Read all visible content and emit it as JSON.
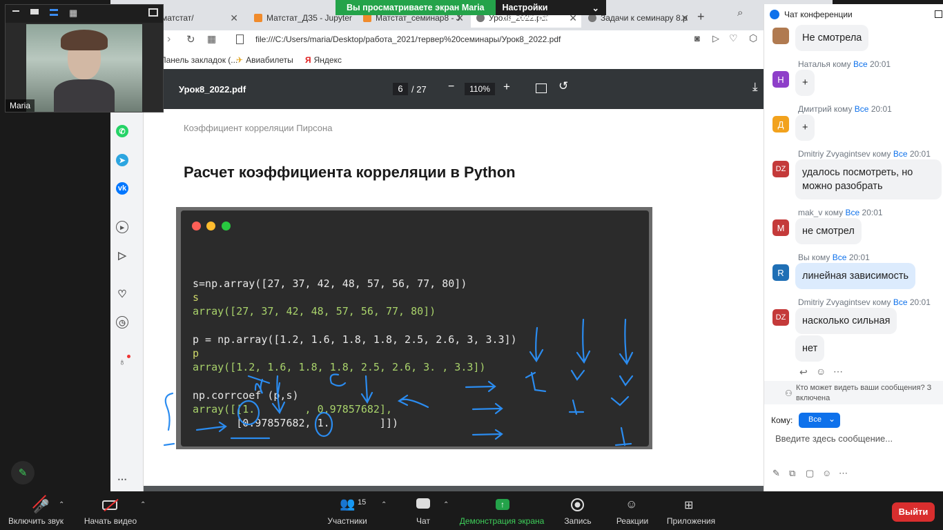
{
  "banner": {
    "viewing_text": "Вы просматриваете экран Maria",
    "options_label": "Настройки просмотра"
  },
  "video": {
    "name": "Maria"
  },
  "browser": {
    "tabs": [
      {
        "label": "матстат/"
      },
      {
        "label": "Матстат_ДЗ5 - Jupyter"
      },
      {
        "label": "Матстат_семинар8 - J"
      },
      {
        "label": "Урок8_2022.pdf"
      },
      {
        "label": "Задачи к семинару 8.p"
      }
    ],
    "url": "file:///C:/Users/maria/Desktop/работа_2021/тервер%20семинары/Урок8_2022.pdf",
    "bookmarks": [
      {
        "label": "Панель закладок (..."
      },
      {
        "label": "Авиабилеты"
      },
      {
        "label": "Яндекс"
      }
    ]
  },
  "pdf": {
    "filename": "Урок8_2022.pdf",
    "page_current": "6",
    "page_total": "/ 27",
    "zoom": "110%",
    "page_header": "Коэффициент корреляции Пирсона",
    "page_title": "Расчет коэффициента корреляции в Python",
    "code_lines": [
      "s=np.array([27, 37, 42, 48, 57, 56, 77, 80])",
      "s",
      "array([27, 37, 42, 48, 57, 56, 77, 80])",
      "p = np.array([1.2, 1.6, 1.8, 1.8, 2.5, 2.6, 3, 3.3])",
      "p",
      "array([1.2, 1.6, 1.8, 1.8, 2.5, 2.6, 3. , 3.3])",
      "np.corrcoef (p,s)",
      "array([[1.        , 0.97857682],",
      "       [0.97857682, 1.        ]])"
    ]
  },
  "chat": {
    "title": "Чат конференции",
    "messages": [
      {
        "avatar": "",
        "sender": "",
        "to_label": "",
        "to": "",
        "time": "",
        "text": "Не смотрела",
        "avatar_color": "#b07a50"
      },
      {
        "avatar": "Н",
        "sender": "Наталья",
        "to_label": "кому",
        "to": "Все",
        "time": "20:01",
        "text": "+",
        "avatar_color": "#8e3fc9"
      },
      {
        "avatar": "Д",
        "sender": "Дмитрий",
        "to_label": "кому",
        "to": "Все",
        "time": "20:01",
        "text": "+",
        "avatar_color": "#f2a21d"
      },
      {
        "avatar": "DZ",
        "sender": "Dmitriy Zvyagintsev",
        "to_label": "кому",
        "to": "Все",
        "time": "20:01",
        "text": "удалось посмотреть, но можно разобрать",
        "avatar_color": "#c43a3a"
      },
      {
        "avatar": "M",
        "sender": "mak_v",
        "to_label": "кому",
        "to": "Все",
        "time": "20:01",
        "text": "не смотрел",
        "avatar_color": "#c43a3a"
      },
      {
        "avatar": "R",
        "sender": "Вы",
        "to_label": "кому",
        "to": "Все",
        "time": "20:01",
        "text": "линейная зависимость",
        "avatar_color": "#1f6fb5"
      },
      {
        "avatar": "DZ",
        "sender": "Dmitriy Zvyagintsev",
        "to_label": "кому",
        "to": "Все",
        "time": "20:01",
        "text": "насколько сильная",
        "avatar_color": "#c43a3a"
      },
      {
        "avatar": "",
        "sender": "",
        "to_label": "",
        "to": "",
        "time": "",
        "text": "нет",
        "avatar_color": ""
      }
    ],
    "privacy_note_1": "Кто может видеть ваши сообщения? З",
    "privacy_note_2": "включена",
    "to_label": "Кому:",
    "recipient": "Все",
    "input_placeholder": "Введите здесь сообщение..."
  },
  "toolbar": {
    "unmute": "Включить звук",
    "start_video": "Начать видео",
    "participants": "Участники",
    "participants_count": "15",
    "chat": "Чат",
    "share": "Демонстрация экрана",
    "record": "Запись",
    "reactions": "Реакции",
    "apps": "Приложения",
    "leave": "Выйти"
  },
  "colors": {
    "share_green": "#24a34a",
    "leave_red": "#d92e2e",
    "zoom_blue": "#0e71eb"
  }
}
